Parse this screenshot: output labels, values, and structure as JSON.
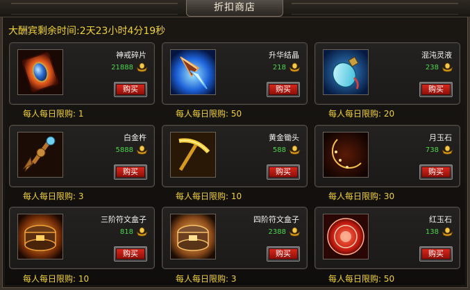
{
  "window": {
    "title": "折扣商店"
  },
  "timer": {
    "text": "大酬宾剩余时间:2天23小时4分19秒"
  },
  "currency_icon": "gold-ingot-icon",
  "colors": {
    "timer": "#f0d23a",
    "price": "#4cd84c",
    "buy_button": "#c21c12"
  },
  "items": [
    {
      "name": "神戒碎片",
      "price": "21888",
      "buy_label": "购买",
      "limit_label": "每人每日限购:",
      "limit_value": "1",
      "icon": "ring-shard-icon"
    },
    {
      "name": "升华结晶",
      "price": "218",
      "buy_label": "购买",
      "limit_label": "每人每日限购:",
      "limit_value": "50",
      "icon": "crystal-cone-icon"
    },
    {
      "name": "混沌灵液",
      "price": "238",
      "buy_label": "购买",
      "limit_label": "每人每日限购:",
      "limit_value": "20",
      "icon": "potion-bottle-icon"
    },
    {
      "name": "白金杵",
      "price": "5888",
      "buy_label": "购买",
      "limit_label": "每人每日限购:",
      "limit_value": "3",
      "icon": "vajra-pestle-icon"
    },
    {
      "name": "黄金锄头",
      "price": "588",
      "buy_label": "购买",
      "limit_label": "每人每日限购:",
      "limit_value": "10",
      "icon": "pickaxe-icon"
    },
    {
      "name": "月玉石",
      "price": "738",
      "buy_label": "购买",
      "limit_label": "每人每日限购:",
      "limit_value": "30",
      "icon": "crescent-moon-icon"
    },
    {
      "name": "三阶符文盒子",
      "price": "818",
      "buy_label": "购买",
      "limit_label": "每人每日限购:",
      "limit_value": "10",
      "icon": "rune-box-icon"
    },
    {
      "name": "四阶符文盒子",
      "price": "2388",
      "buy_label": "购买",
      "limit_label": "每人每日限购:",
      "limit_value": "3",
      "icon": "rune-box-icon"
    },
    {
      "name": "红玉石",
      "price": "138",
      "buy_label": "购买",
      "limit_label": "每人每日限购:",
      "limit_value": "50",
      "icon": "red-jade-disc-icon"
    }
  ]
}
